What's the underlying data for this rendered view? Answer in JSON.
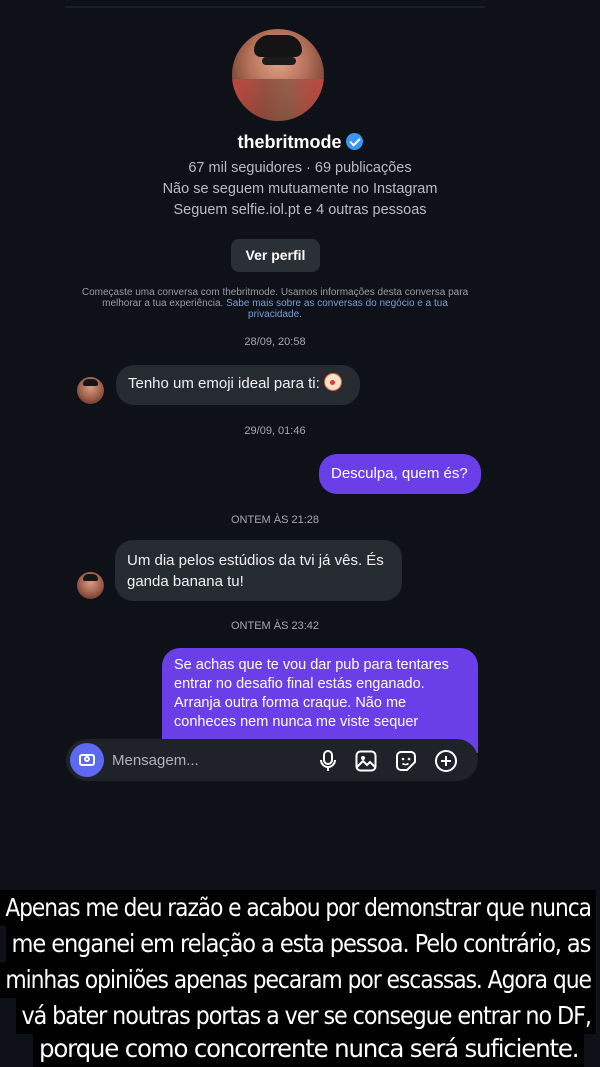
{
  "profile": {
    "username": "thebritmode",
    "stats": "67 mil seguidores · 69 publicações",
    "mutual": "Não se seguem mutuamente no Instagram",
    "followed_by": "Seguem selfie.iol.pt e 4 outras pessoas",
    "view_profile_label": "Ver perfil"
  },
  "notice": {
    "text": "Começaste uma conversa com thebritmode. Usamos informações desta conversa para melhorar a tua experiência.",
    "link": "Sabe mais sobre as conversas do negócio e a tua privacidade."
  },
  "messages": [
    {
      "timestamp": "28/09, 20:58",
      "direction": "incoming",
      "text": "Tenho um emoji ideal para ti:",
      "emoji": "clown-face"
    },
    {
      "timestamp": "29/09, 01:46",
      "direction": "outgoing",
      "text": "Desculpa, quem és?"
    },
    {
      "timestamp": "ONTEM ÀS 21:28",
      "direction": "incoming",
      "lines": [
        "Um dia pelos estúdios da tvi já vês. És",
        "ganda banana tu!"
      ]
    },
    {
      "timestamp": "ONTEM ÀS 23:42",
      "direction": "outgoing",
      "lines": [
        "Se achas que te vou dar pub para tentares",
        "entrar no desafio final estás enganado.",
        "Arranja outra forma craque. Não me",
        "conheces nem nunca me viste sequer"
      ]
    }
  ],
  "composer": {
    "placeholder": "Mensagem...",
    "icons": [
      "camera-icon",
      "microphone-icon",
      "gallery-icon",
      "sticker-icon",
      "add-icon"
    ]
  },
  "caption": [
    "Apenas me deu razão e acabou por demonstrar que nunca",
    "me enganei em relação a esta pessoa. Pelo contrário, as",
    "minhas opiniões apenas pecaram por escassas. Agora que",
    "vá bater noutras portas a ver se consegue entrar no DF,",
    "porque como concorrente nunca será suficiente."
  ],
  "colors": {
    "background": "#0e1117",
    "incoming_bubble": "#262a31",
    "outgoing_bubble": "#6b3fe8",
    "verified": "#3897f0",
    "camera_button": "#5b6af0",
    "link": "#7a9cd6"
  }
}
